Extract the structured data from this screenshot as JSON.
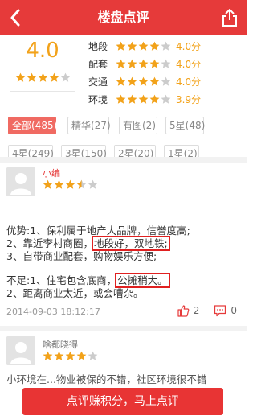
{
  "header": {
    "title": "楼盘点评"
  },
  "summary": {
    "score": "4.0",
    "score_stars": 4,
    "metrics": [
      {
        "label": "地段",
        "stars": 4,
        "value": "4.0分"
      },
      {
        "label": "配套",
        "stars": 4,
        "value": "4.0分"
      },
      {
        "label": "交通",
        "stars": 4,
        "value": "4.0分"
      },
      {
        "label": "环境",
        "stars": 4,
        "value": "3.9分"
      }
    ]
  },
  "filters": [
    {
      "label": "全部(485)",
      "active": true
    },
    {
      "label": "精华(27)",
      "active": false
    },
    {
      "label": "有图(2)",
      "active": false
    },
    {
      "label": "5星(48)",
      "active": false
    },
    {
      "label": "4星(249)",
      "active": false
    },
    {
      "label": "3星(150)",
      "active": false
    },
    {
      "label": "2星(20)",
      "active": false
    },
    {
      "label": "1星(2)",
      "active": false
    }
  ],
  "reviews": [
    {
      "name": "小编",
      "stars": 3.5,
      "lines": {
        "l1": "优势:1、保利属于地产大品牌，信誉度高;",
        "l2a": "2、靠近李村商圈，",
        "l2b": "地段好，双地铁;",
        "l3": "3、自带商业配套，购物娱乐方便;",
        "l4a": "不足:1、住宅包含底商，",
        "l4b": "公摊稍大。",
        "l5": "2、距离商业太近，或会嘈杂。"
      },
      "time": "2014-09-03 18:12:17",
      "likes": "2",
      "comments": "0"
    },
    {
      "name": "啥都晓得",
      "stars": 4,
      "partial_text": "小环境在...物业被保的不错，社区环境很不错"
    }
  ],
  "cta": {
    "label": "点评赚积分，马上点评"
  },
  "colors": {
    "brand": "#e63a3a",
    "star": "#f2a21a",
    "star_empty": "#cccccc"
  }
}
